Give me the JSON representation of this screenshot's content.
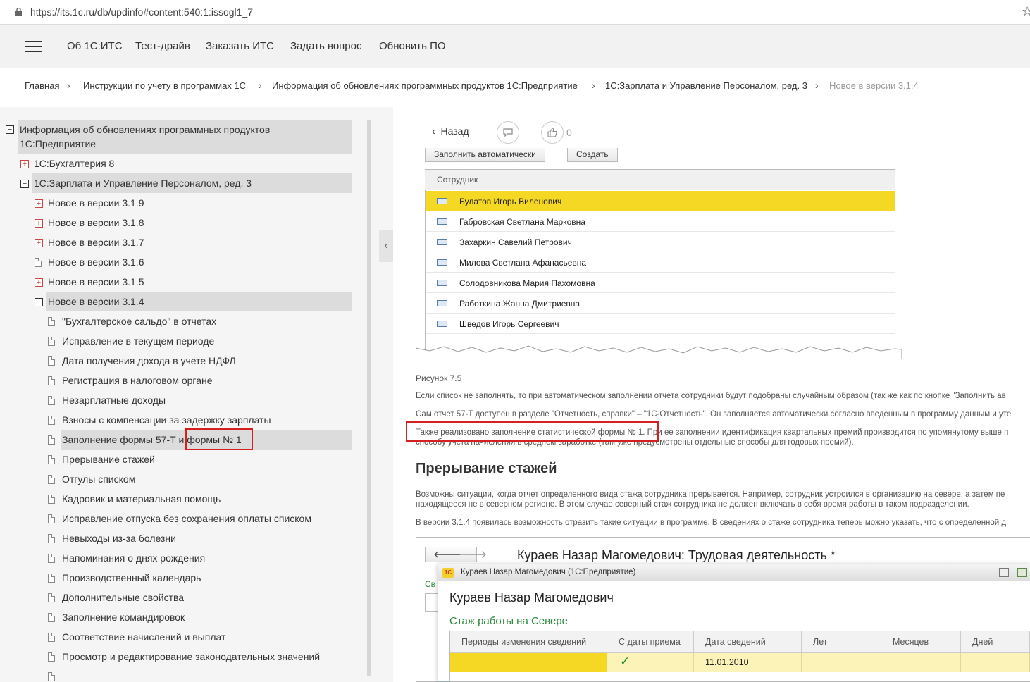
{
  "browser": {
    "url": "https://its.1c.ru/db/updinfo#content:540:1:issogl1_7"
  },
  "topnav": {
    "items": [
      "Об 1С:ИТС",
      "Тест-драйв",
      "Заказать ИТС",
      "Задать вопрос",
      "Обновить ПО"
    ]
  },
  "breadcrumb": {
    "items": [
      "Главная",
      "Инструкции по учету в программах 1С",
      "Информация об обновлениях программных продуктов 1С:Предприятие",
      "1С:Зарплата и Управление Персоналом, ред. 3",
      "Новое в версии 3.1.4"
    ]
  },
  "tree": {
    "root_line1": "Информация об обновлениях программных продуктов",
    "root_line2": "1С:Предприятие",
    "products": [
      "1С:Бухгалтерия 8",
      "1С:Зарплата и Управление Персоналом, ред. 3"
    ],
    "versions": [
      "Новое в версии 3.1.9",
      "Новое в версии 3.1.8",
      "Новое в версии 3.1.7",
      "Новое в версии 3.1.6",
      "Новое в версии 3.1.5",
      "Новое в версии 3.1.4"
    ],
    "topics": [
      "\"Бухгалтерское сальдо\" в отчетах",
      "Исправление в текущем периоде",
      "Дата получения дохода в учете НДФЛ",
      "Регистрация в налоговом органе",
      "Незарплатные доходы",
      "Взносы с компенсации за задержку зарплаты",
      "Заполнение формы 57-Т и формы № 1",
      "Прерывание стажей",
      "Отгулы списком",
      "Кадровик и материальная помощь",
      "Исправление отпуска без сохранения оплаты списком",
      "Невыходы из-за болезни",
      "Напоминания о днях рождения",
      "Производственный календарь",
      "Дополнительные свойства",
      "Заполнение командировок",
      "Соответствие начислений и выплат",
      "Просмотр и редактирование законодательных значений"
    ]
  },
  "article": {
    "back_label": "Назад",
    "like_count": "0",
    "fill_auto": "Заполнить автоматически",
    "create": "Создать",
    "employee_header": "Сотрудник",
    "employees": [
      "Булатов Игорь Виленович",
      "Габровская Светлана Марковна",
      "Захаркин Савелий Петрович",
      "Милова Светлана Афанасьевна",
      "Солодовникова Мария Пахомовна",
      "Работкина Жанна Дмитриевна",
      "Шведов Игорь Сергеевич"
    ],
    "figure_caption": "Рисунок 7.5",
    "p1": "Если список не заполнять, то при автоматическом заполнении отчета сотрудники будут подобраны случайным образом (так же как по кнопке \"Заполнить ав",
    "p2": "Сам отчет 57-Т доступен в разделе \"Отчетность, справки\" – \"1С-Отчетность\". Он заполняется автоматически согласно введенным в программу данным и уте",
    "p3": "Также реализовано заполнение статистической формы № 1. При ее заполнении идентификация квартальных премий производится по упомянутому выше п",
    "p3b": "способу учета начисления в среднем заработке (там уже предусмотрены отдельные способы для годовых премий).",
    "heading": "Прерывание стажей",
    "p4": "Возможны ситуации, когда отчет определенного вида стажа сотрудника прерывается. Например, сотрудник устроился в организацию на севере, а затем пе",
    "p4b": "находящееся не в северном регионе. В этом случае северный стаж сотрудника не должен включать в себя время работы в таком подразделении.",
    "p5": "В версии 3.1.4 появилась возможность отразить такие ситуации в программе. В сведениях о стаже сотрудника теперь можно указать, что с определенной д"
  },
  "screen2": {
    "bg_title": "Кураев Назар Магомедович: Трудовая деятельность *",
    "bg_green": "Св",
    "win_title": "Кураев Назар Магомедович  (1С:Предприятие)",
    "logo_text": "1С",
    "person": "Кураев Назар Магомедович",
    "section": "Стаж работы на Севере",
    "columns": [
      "Периоды изменения сведений",
      "С даты приема",
      "Дата сведений",
      "Лет",
      "Месяцев",
      "Дней"
    ],
    "row": {
      "check": "✓",
      "date": "11.01.2010"
    }
  }
}
